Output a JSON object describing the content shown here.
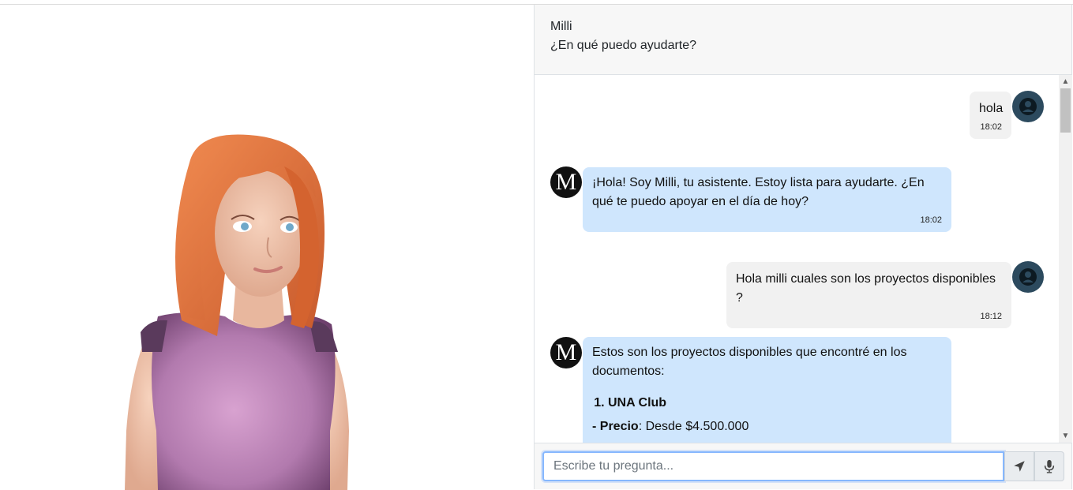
{
  "header": {
    "bot_name": "Milli",
    "greeting": "¿En qué puedo ayudarte?"
  },
  "messages": [
    {
      "from": "user",
      "text": "hola",
      "time": "18:02"
    },
    {
      "from": "bot",
      "avatar_letter": "M",
      "text": "¡Hola! Soy Milli, tu asistente. Estoy lista para ayudarte. ¿En qué te puedo apoyar en el día de hoy?",
      "time": "18:02"
    },
    {
      "from": "user",
      "text": "Hola milli cuales son los proyectos disponibles ?",
      "time": "18:12"
    },
    {
      "from": "bot",
      "avatar_letter": "M",
      "intro": "Estos son los proyectos disponibles que encontré en los documentos:",
      "list_item": "UNA Club",
      "detail_label": "- Precio",
      "detail_value": ": Desde $4.500.000"
    }
  ],
  "input": {
    "placeholder": "Escribe tu pregunta...",
    "value": ""
  },
  "icons": {
    "send": "send-arrow-icon",
    "mic": "microphone-icon",
    "user": "user-avatar-icon"
  },
  "colors": {
    "bot_bubble": "#cfe6fd",
    "user_bubble": "#f1f1f1",
    "user_avatar": "#2c4a5e",
    "hair": "#e0703a",
    "top": "#c98fc2"
  }
}
